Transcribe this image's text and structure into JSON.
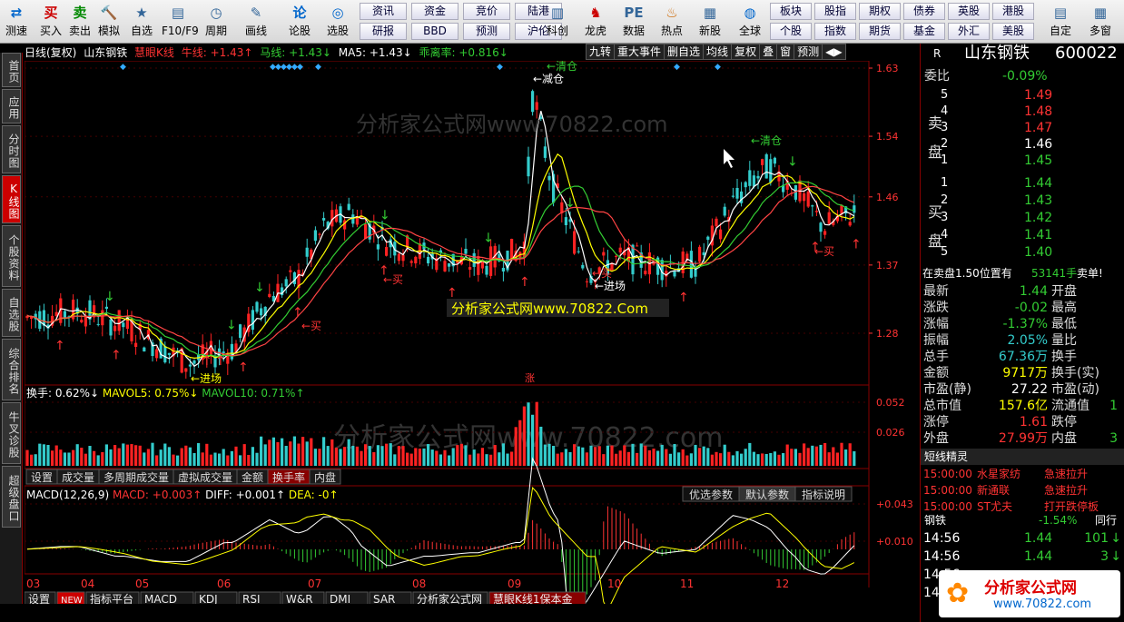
{
  "toolbar": {
    "buttons": [
      {
        "label": "测速",
        "icon": "⇄",
        "color": "#06c"
      },
      {
        "label": "买入",
        "icon": "买",
        "color": "#c00"
      },
      {
        "label": "卖出",
        "icon": "卖",
        "color": "#080"
      },
      {
        "label": "模拟",
        "icon": "🔨",
        "color": "#a60"
      },
      {
        "label": "自选",
        "icon": "★",
        "color": "#369"
      },
      {
        "label": "F10/F9",
        "icon": "▤",
        "color": "#369"
      },
      {
        "label": "周期",
        "icon": "◷",
        "color": "#369"
      },
      {
        "label": "画线",
        "icon": "✎",
        "color": "#369"
      },
      {
        "label": "论股",
        "icon": "论",
        "color": "#06c"
      },
      {
        "label": "选股",
        "icon": "◎",
        "color": "#06c"
      }
    ],
    "small_top": [
      "资讯",
      "资金",
      "竞价",
      "陆港"
    ],
    "small_bot": [
      "研报",
      "BBD",
      "预测",
      "沪伦"
    ],
    "buttons2": [
      {
        "label": "科创",
        "icon": "▥",
        "color": "#369"
      },
      {
        "label": "龙虎",
        "icon": "♞",
        "color": "#c00"
      },
      {
        "label": "数据",
        "icon": "PE",
        "color": "#369"
      },
      {
        "label": "热点",
        "icon": "♨",
        "color": "#c60"
      },
      {
        "label": "新股",
        "icon": "▦",
        "color": "#369"
      },
      {
        "label": "全球",
        "icon": "◍",
        "color": "#06c"
      }
    ],
    "small2_top": [
      "板块",
      "股指",
      "期权",
      "债券",
      "英股",
      "港股"
    ],
    "small2_bot": [
      "个股",
      "指数",
      "期货",
      "基金",
      "外汇",
      "美股"
    ],
    "buttons3": [
      {
        "label": "自定",
        "icon": "▤",
        "color": "#369"
      },
      {
        "label": "多窗",
        "icon": "▦",
        "color": "#369"
      }
    ]
  },
  "leftnav": [
    "首页",
    "应用",
    "分时图",
    "K线图",
    "个股资料",
    "自选股",
    "综合排名",
    "牛叉诊股",
    "超级盘口"
  ],
  "topinfo": {
    "period": "日线(复权)",
    "stock": "山东钢铁",
    "indicator": "慧眼K线",
    "bull": "牛线: +1.43↑",
    "horse": "马线: +1.43↓",
    "ma5": "MA5: +1.43↓",
    "bias": "乖离率: +0.816↓"
  },
  "rtools": [
    "九转",
    "重大事件",
    "删自选",
    "均线",
    "复权",
    "叠",
    "窗",
    "预测",
    "◀▶"
  ],
  "annotations": {
    "clear": "清仓",
    "clear2": "清仓",
    "reduce": "减仓",
    "buy": "买",
    "enter": "进场",
    "limit": "涨"
  },
  "watermark": "分析家公式网www.70822.com",
  "watermark2": "分析家公式网www.70822.Com",
  "price_axis": [
    "1.63",
    "1.54",
    "1.46",
    "1.37",
    "1.28"
  ],
  "vol_info": {
    "hs": "换手: 0.62%↓",
    "mavol5": "MAVOL5: 0.75%↓",
    "mavol10": "MAVOL10: 0.71%↑"
  },
  "vol_axis": [
    "0.052",
    "0.026"
  ],
  "vol_tabs": [
    "设置",
    "成交量",
    "多周期成交量",
    "虚拟成交量",
    "金额",
    "换手率",
    "内盘"
  ],
  "macd_info": {
    "macd": "MACD(12,26,9)",
    "m": "MACD: +0.003↑",
    "diff": "DIFF: +0.001↑",
    "dea": "DEA: -0↑"
  },
  "macd_tabs": [
    "优选参数",
    "默认参数",
    "指标说明"
  ],
  "macd_axis": [
    "+0.043",
    "+0.010"
  ],
  "x_axis": [
    "03",
    "04",
    "05",
    "06",
    "07",
    "08",
    "09",
    "10",
    "11",
    "12"
  ],
  "bottom_tabs": [
    "设置",
    "NEW",
    "指标平台",
    "MACD",
    "KDJ",
    "RSI",
    "W&R",
    "DMI",
    "SAR",
    "分析家公式网",
    "慧眼K线1保本金"
  ],
  "panel": {
    "r": "R",
    "name": "山东钢铁",
    "code": "600022",
    "wb_label": "委比",
    "wb": "-0.09%",
    "sell_label": "卖盘",
    "buy_label": "买盘",
    "sells": [
      {
        "n": "5",
        "p": "1.49"
      },
      {
        "n": "4",
        "p": "1.48"
      },
      {
        "n": "3",
        "p": "1.47"
      },
      {
        "n": "2",
        "p": "1.46"
      },
      {
        "n": "1",
        "p": "1.45"
      }
    ],
    "buys": [
      {
        "n": "1",
        "p": "1.44"
      },
      {
        "n": "2",
        "p": "1.43"
      },
      {
        "n": "3",
        "p": "1.42"
      },
      {
        "n": "4",
        "p": "1.41"
      },
      {
        "n": "5",
        "p": "1.40"
      }
    ],
    "notice": "在卖盘1.50位置有",
    "notice_vol": "53141手",
    "notice_tag": "卖单!",
    "stats": [
      {
        "l": "最新",
        "v": "1.44",
        "c": "green",
        "r": "开盘"
      },
      {
        "l": "涨跌",
        "v": "-0.02",
        "c": "green",
        "r": "最高"
      },
      {
        "l": "涨幅",
        "v": "-1.37%",
        "c": "green",
        "r": "最低"
      },
      {
        "l": "振幅",
        "v": "2.05%",
        "c": "cyan",
        "r": "量比"
      },
      {
        "l": "总手",
        "v": "67.36万",
        "c": "cyan",
        "r": "换手"
      },
      {
        "l": "金额",
        "v": "9717万",
        "c": "yellow",
        "r": "换手(实)"
      },
      {
        "l": "市盈(静)",
        "v": "27.22",
        "c": "white",
        "r": "市盈(动)"
      },
      {
        "l": "总市值",
        "v": "157.6亿",
        "c": "yellow",
        "r": "流通值"
      },
      {
        "l": "涨停",
        "v": "1.61",
        "c": "red",
        "r": "跌停"
      },
      {
        "l": "外盘",
        "v": "27.99万",
        "c": "red",
        "r": "内盘"
      }
    ],
    "stat_extra": [
      "1",
      "3"
    ],
    "spirit_title": "短线精灵",
    "spirit": [
      {
        "t": "15:00:00",
        "n": "水星家纺",
        "e": "急速拉升"
      },
      {
        "t": "15:00:00",
        "n": "新通联",
        "e": "急速拉升"
      },
      {
        "t": "15:00:00",
        "n": "ST尤夫",
        "e": "打开跌停板"
      }
    ],
    "sector": "钢铁",
    "sector_chg": "-1.54%",
    "sector_tag": "同行",
    "ticks": [
      {
        "t": "14:56",
        "p": "1.44",
        "v": "101",
        "d": "↓"
      },
      {
        "t": "14:56",
        "p": "1.44",
        "v": "3",
        "d": "↓"
      },
      {
        "t": "14:56",
        "p": "",
        "v": "",
        "d": ""
      },
      {
        "t": "14:56",
        "p": "",
        "v": "",
        "d": ""
      }
    ],
    "logo": "分析家公式网",
    "logo_url": "www.70822.com"
  },
  "chart_data": {
    "type": "candlestick",
    "x": [
      "03",
      "04",
      "05",
      "06",
      "07",
      "08",
      "09",
      "10",
      "11",
      "12"
    ],
    "price_ticks": [
      1.63,
      1.54,
      1.46,
      1.37,
      1.28
    ],
    "ylim": [
      1.22,
      1.63
    ]
  }
}
